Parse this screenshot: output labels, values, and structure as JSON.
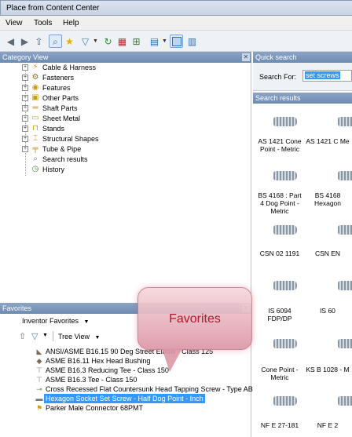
{
  "window": {
    "title": "Place from Content Center"
  },
  "menu": [
    "View",
    "Tools",
    "Help"
  ],
  "category_view": {
    "title": "Category View",
    "items": [
      {
        "label": "Cable & Harness",
        "icon": "cable-icon",
        "expandable": true
      },
      {
        "label": "Fasteners",
        "icon": "bolt-icon",
        "expandable": true
      },
      {
        "label": "Features",
        "icon": "feature-icon",
        "expandable": true
      },
      {
        "label": "Other Parts",
        "icon": "cube-icon",
        "expandable": true
      },
      {
        "label": "Shaft Parts",
        "icon": "shaft-icon",
        "expandable": true
      },
      {
        "label": "Sheet Metal",
        "icon": "sheet-icon",
        "expandable": true
      },
      {
        "label": "Stands",
        "icon": "stand-icon",
        "expandable": true
      },
      {
        "label": "Structural Shapes",
        "icon": "beam-icon",
        "expandable": true
      },
      {
        "label": "Tube & Pipe",
        "icon": "pipe-icon",
        "expandable": true
      },
      {
        "label": "Search results",
        "icon": "search-icon",
        "expandable": false
      },
      {
        "label": "History",
        "icon": "history-icon",
        "expandable": false
      }
    ]
  },
  "favorites": {
    "title": "Favorites",
    "dropdown": "Inventor Favorites",
    "view_mode": "Tree View",
    "items": [
      {
        "label": "ANSI/ASME B16.15 90 Deg Street Elbow - Class 125",
        "selected": false
      },
      {
        "label": "ASME B16.11 Hex Head Bushing",
        "selected": false
      },
      {
        "label": "ASME B16.3 Reducing Tee - Class 150",
        "selected": false
      },
      {
        "label": "ASME B16.3 Tee - Class 150",
        "selected": false
      },
      {
        "label": "Cross Recessed Flat Countersunk Head Tapping Screw - Type AB",
        "selected": false
      },
      {
        "label": "Hexagon Socket Set Screw - Half Dog Point - Inch",
        "selected": true
      },
      {
        "label": "Parker Male Connector 68PMT",
        "selected": false
      }
    ]
  },
  "quick_search": {
    "title": "Quick search",
    "label": "Search For:",
    "value": "set screws"
  },
  "search_results": {
    "title": "Search results",
    "items": [
      "AS 1421 Cone Point - Metric",
      "AS 1421 C Me",
      "BS 4168 : Part 4 Dog Point - Metric",
      "BS 4168 Hexagon",
      "CSN 02 1191",
      "CSN EN",
      "IS 6094 FDP/DP",
      "IS 60",
      "Cone Point - Metric",
      "KS B 1028 - M",
      "NF E 27-181",
      "NF E 2"
    ]
  },
  "callout": {
    "label": "Favorites"
  }
}
